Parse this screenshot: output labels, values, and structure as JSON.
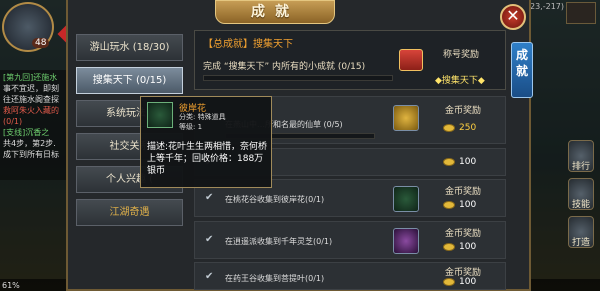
{
  "hud": {
    "level": "48",
    "battery": "61%",
    "coords": "24 (23,-217)"
  },
  "chat": [
    {
      "text": "[第九回]还施水",
      "cls": "c-green"
    },
    {
      "text": "事不宜迟，即刻",
      "cls": "c-white"
    },
    {
      "text": "往还施水阁查探",
      "cls": "c-white"
    },
    {
      "text": "救阿朱火入藏的",
      "cls": "c-red"
    },
    {
      "text": "(0/1)",
      "cls": "c-red"
    },
    {
      "text": "[支线]沉香之",
      "cls": "c-green"
    },
    {
      "text": "共4步，第2步.",
      "cls": "c-white"
    },
    {
      "text": "成下到所有日标",
      "cls": "c-white"
    }
  ],
  "panel": {
    "title": "成就",
    "close": "✕",
    "right_tab": "成就"
  },
  "tabs": [
    {
      "label": "游山玩水 (18/30)",
      "active": false
    },
    {
      "label": "搜集天下 (0/15)",
      "active": true
    },
    {
      "label": "系统玩法 (",
      "active": false
    },
    {
      "label": "社交关系",
      "active": false
    },
    {
      "label": "个人兴趣 (",
      "active": false
    },
    {
      "label": "江湖奇遇",
      "active": false,
      "gold": true
    }
  ],
  "summary": {
    "header": "【总成就】搜集天下",
    "desc": "完成 “搜集天下” 内所有的小成就 (0/15)",
    "progress": 0,
    "reward_label": "称号奖励",
    "reward_title": "◆搜集天下◆"
  },
  "rows": [
    {
      "text": "在燕山中…所和名最的仙草 (0/5)",
      "reward_label": "金币奖励",
      "coins": "250",
      "check": "",
      "coins_gold": true
    },
    {
      "text": "",
      "reward_label": "",
      "coins": "100",
      "check": "✔"
    },
    {
      "text": "在桃花谷收集到彼岸花(0/1)",
      "reward_label": "金币奖励",
      "coins": "100",
      "check": "✔"
    },
    {
      "text": "在逍遥派收集到千年灵芝(0/1)",
      "reward_label": "金币奖励",
      "coins": "100",
      "check": "✔"
    },
    {
      "text": "在药王谷收集到菩提叶(0/1)",
      "reward_label": "金币奖励",
      "coins": "100",
      "check": "✔"
    }
  ],
  "tooltip": {
    "name": "彼岸花",
    "category": "分类: 特殊道具",
    "level": "等级: 1",
    "description": "描述:花叶生生两相惜，奈何桥上等千年；回收价格：188万银币"
  },
  "side_buttons": [
    "排行",
    "技能",
    "打造"
  ]
}
